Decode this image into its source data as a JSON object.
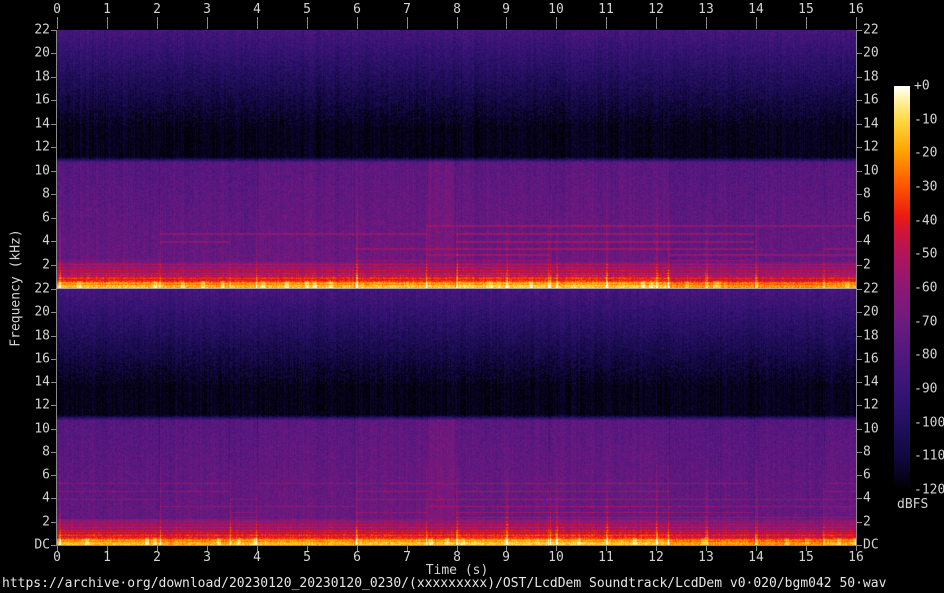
{
  "figure": {
    "xlabel": "Time (s)",
    "ylabel": "Frequency (kHz)",
    "footer_url": "https://archive·org/download/20230120_20230120_0230/(xxxxxxxxx)/OST/LcdDem Soundtrack/LcdDem v0·020/bgm042 50·wav"
  },
  "axes": {
    "time_ticks": [
      "0",
      "1",
      "2",
      "3",
      "4",
      "5",
      "6",
      "7",
      "8",
      "9",
      "10",
      "11",
      "12",
      "13",
      "14",
      "15",
      "16"
    ],
    "freq_ticks_ch1": [
      "22",
      "20",
      "18",
      "16",
      "14",
      "12",
      "10",
      "8",
      "6",
      "4",
      "2"
    ],
    "freq_ticks_ch2": [
      "22",
      "20",
      "18",
      "16",
      "14",
      "12",
      "10",
      "8",
      "6",
      "4",
      "2",
      "DC"
    ]
  },
  "colorbar": {
    "unit": "dBFS",
    "ticks": [
      "+0",
      "-10",
      "-20",
      "-30",
      "-40",
      "-50",
      "-60",
      "-70",
      "-80",
      "-90",
      "-100",
      "-110",
      "-120"
    ]
  },
  "chart_data": {
    "type": "heatmap",
    "subtype": "audio-spectrogram",
    "channels": 2,
    "title": "",
    "xlabel": "Time (s)",
    "ylabel": "Frequency (kHz)",
    "x_range_s": [
      0,
      16
    ],
    "y_range_khz": [
      0,
      22
    ],
    "level_range_dbfs": [
      0,
      -120
    ],
    "legend_position": "right-colorbar",
    "grid": false,
    "palette": [
      {
        "p": 0.0,
        "c": "#000000"
      },
      {
        "p": 0.08,
        "c": "#10083e"
      },
      {
        "p": 0.17,
        "c": "#241060"
      },
      {
        "p": 0.25,
        "c": "#381476"
      },
      {
        "p": 0.34,
        "c": "#52187e"
      },
      {
        "p": 0.42,
        "c": "#6e1a80"
      },
      {
        "p": 0.5,
        "c": "#8c1874"
      },
      {
        "p": 0.58,
        "c": "#b0145c"
      },
      {
        "p": 0.64,
        "c": "#d01438"
      },
      {
        "p": 0.68,
        "c": "#ec1c10"
      },
      {
        "p": 0.76,
        "c": "#ff5c00"
      },
      {
        "p": 0.84,
        "c": "#ffa400"
      },
      {
        "p": 0.92,
        "c": "#ffdc48"
      },
      {
        "p": 0.97,
        "c": "#fff4b0"
      },
      {
        "p": 1.0,
        "c": "#ffffff"
      }
    ],
    "features": {
      "top_noise_band_khz": [
        13.8,
        22
      ],
      "silent_gap_khz": [
        11.2,
        13.8
      ],
      "content_band_khz": [
        0,
        11.2
      ],
      "bright_bass_band_khz": [
        0,
        2.2
      ],
      "striation_lines_khz": [
        2.35,
        2.8,
        3.3,
        3.9,
        4.6,
        5.3
      ],
      "low_lines_khz": [
        2.0,
        1.75,
        1.5,
        1.25,
        1.05,
        0.85
      ],
      "onsets_s": [
        0.05,
        2.05,
        3.45,
        4.0,
        6.0,
        7.4,
        8.0,
        9.0,
        9.85,
        10.0,
        11.0,
        12.0,
        12.25,
        13.0,
        14.0,
        15.35
      ],
      "segments": [
        {
          "t0": 0.0,
          "t1": 2.05,
          "body": 0.0,
          "bottom": 0.85,
          "lines": 0.35
        },
        {
          "t0": 2.05,
          "t1": 3.45,
          "body": 0.01,
          "bottom": 0.78,
          "lines": 0.55
        },
        {
          "t0": 3.45,
          "t1": 4.0,
          "body": 0.0,
          "bottom": 0.82,
          "lines": 0.45
        },
        {
          "t0": 4.0,
          "t1": 5.95,
          "body": 0.02,
          "bottom": 0.85,
          "lines": 0.5
        },
        {
          "t0": 5.95,
          "t1": 7.4,
          "body": 0.03,
          "bottom": 0.9,
          "lines": 0.55
        },
        {
          "t0": 7.4,
          "t1": 7.97,
          "body": 0.065,
          "bottom": 0.9,
          "lines": 0.55
        },
        {
          "t0": 7.97,
          "t1": 9.85,
          "body": 0.02,
          "bottom": 0.97,
          "lines": 0.85
        },
        {
          "t0": 9.85,
          "t1": 12.25,
          "body": 0.02,
          "bottom": 0.93,
          "lines": 0.85
        },
        {
          "t0": 12.25,
          "t1": 13.95,
          "body": 0.0,
          "bottom": 0.66,
          "lines": 0.75
        },
        {
          "t0": 13.95,
          "t1": 15.35,
          "body": 0.0,
          "bottom": 0.6,
          "lines": 0.6
        },
        {
          "t0": 15.35,
          "t1": 16.0,
          "body": 0.01,
          "bottom": 0.74,
          "lines": 0.5
        }
      ]
    }
  }
}
